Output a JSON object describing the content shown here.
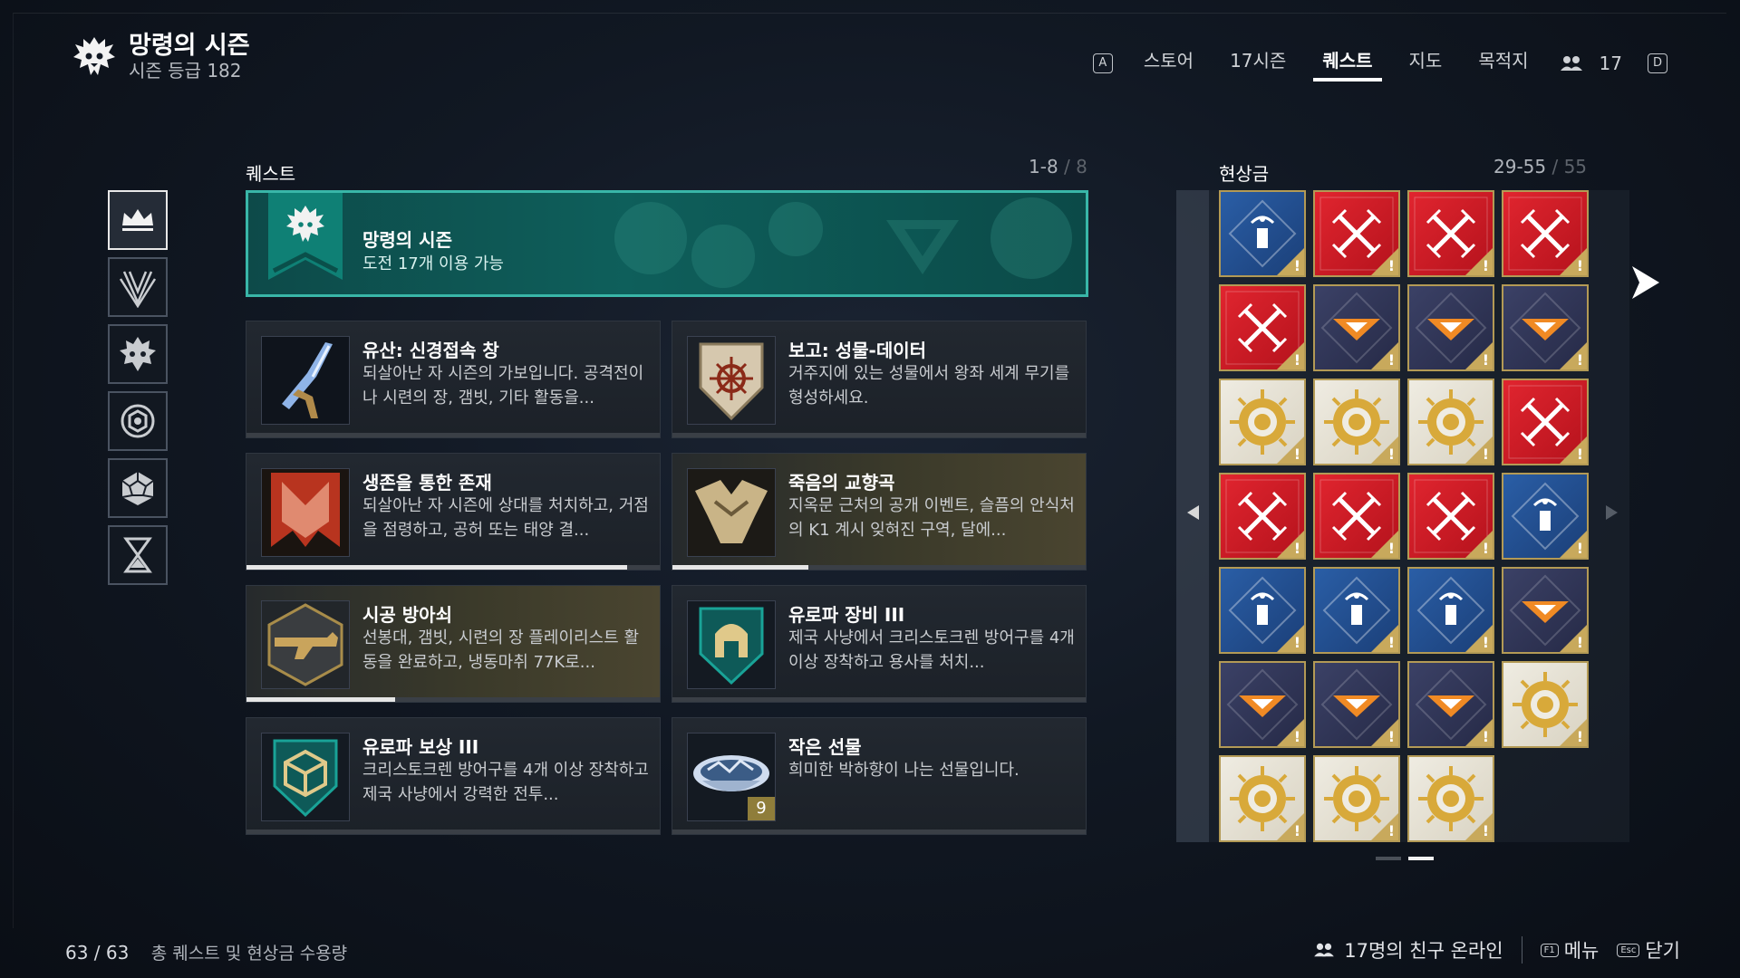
{
  "header": {
    "title": "망령의 시즌",
    "subtitle": "시즌 등급 182",
    "nav": {
      "key_left": "A",
      "items": [
        "스토어",
        "17시즌",
        "퀘스트",
        "지도",
        "목적지"
      ],
      "active_index": 2,
      "friends_count": "17",
      "key_right": "D"
    }
  },
  "rail": {
    "items": [
      "crown-icon",
      "warlock-icon",
      "hive-icon",
      "nine-icon",
      "dodecahedron-icon",
      "hourglass-icon"
    ],
    "active_index": 0
  },
  "quests": {
    "title": "퀘스트",
    "range": "1-8",
    "total": "/ 8",
    "featured": {
      "title": "망령의 시즌",
      "subtitle": "도전 17개 이용 가능"
    },
    "cards": [
      {
        "title": "유산: 신경접속 창",
        "desc": "되살아난 자 시즌의 가보입니다. 공격전이나 시련의 장, 갬빗, 기타 활동을...",
        "progress": 0,
        "style": "dark"
      },
      {
        "title": "보고: 성물-데이터",
        "desc": "거주지에 있는 성물에서 왕좌 세계 무기를 형성하세요.",
        "progress": 0,
        "style": "dark"
      },
      {
        "title": "생존을 통한 존재",
        "desc": "되살아난 자 시즌에 상대를 처치하고, 거점을 점령하고, 공허 또는 태양 결...",
        "progress": 0.92,
        "style": "dark"
      },
      {
        "title": "죽음의 교향곡",
        "desc": "지옥문 근처의 공개 이벤트, 슬픔의 안식처의 K1 계시 잊혀진 구역, 달에...",
        "progress": 0.33,
        "style": "gold"
      },
      {
        "title": "시공 방아쇠",
        "desc": "선봉대, 갬빗, 시련의 장 플레이리스트 활동을 완료하고, 냉동마취 77K로...",
        "progress": 0.36,
        "style": "gold"
      },
      {
        "title": "유로파 장비 III",
        "desc": "제국 사냥에서 크리스토크렌 방어구를 4개 이상 장착하고 용사를 처치...",
        "progress": 0,
        "style": "dark"
      },
      {
        "title": "유로파 보상 III",
        "desc": "크리스토크렌 방어구를 4개 이상 장착하고 제국 사냥에서 강력한 전투...",
        "progress": 0,
        "style": "dark"
      },
      {
        "title": "작은 선물",
        "desc": "희미한 박하향이 나는 선물입니다.",
        "progress": 0,
        "style": "dark",
        "stack": "9"
      }
    ]
  },
  "bounties": {
    "title": "현상금",
    "range": "29-55",
    "total": "/ 55",
    "tiles": [
      "blue",
      "red",
      "red",
      "red",
      "red",
      "navy",
      "navy",
      "navy",
      "sun",
      "sun",
      "sun",
      "red",
      "red",
      "red",
      "red",
      "blue",
      "blue",
      "blue",
      "blue",
      "navy",
      "navy",
      "navy",
      "navy",
      "sun",
      "sun",
      "sun",
      "sun"
    ],
    "tile_alert": "!",
    "colors": {
      "red": "#e1252f",
      "blue": "#2a5ea6",
      "navy": "#3b4166",
      "sun": "#efece2",
      "gold": "#c8a95c"
    }
  },
  "footer": {
    "count": "63 / 63",
    "count_label": "총 퀘스트 및 현상금 수용량",
    "friends_online": "17명의 친구 온라인",
    "menu_key": "F1",
    "menu_label": "메뉴",
    "close_key": "Esc",
    "close_label": "닫기"
  },
  "colors": {
    "accent_teal": "#39b6a8",
    "gold_badge": "#c8a95c"
  }
}
